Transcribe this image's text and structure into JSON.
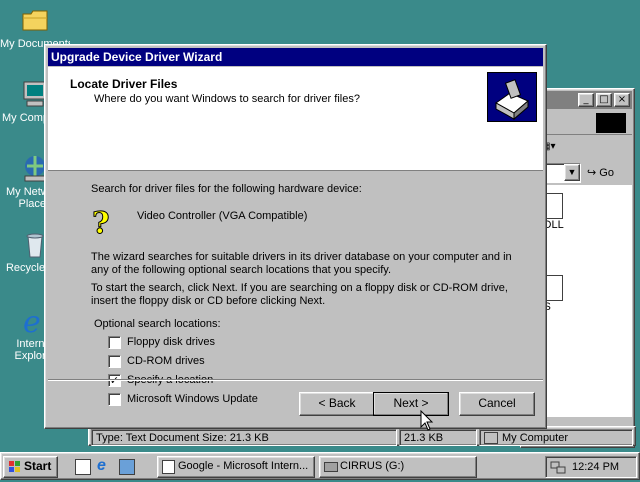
{
  "desktop": {
    "icons": [
      {
        "label": "My Documents",
        "icon": "folder-icon"
      },
      {
        "label": "My Computer",
        "icon": "computer-icon"
      },
      {
        "label": "My Network Places",
        "icon": "network-icon"
      },
      {
        "label": "Recycle Bin",
        "icon": "recycle-bin-icon"
      },
      {
        "label": "Internet Explorer",
        "icon": "ie-icon"
      }
    ]
  },
  "background_window": {
    "go_label": "Go",
    "file1": "EL.DLL",
    "file2": "NGS",
    "status_left": "Type: Text Document Size: 21.3 KB",
    "status_mid": "21.3 KB",
    "status_right": "My Computer"
  },
  "dialog": {
    "title": "Upgrade Device Driver Wizard",
    "header_title": "Locate Driver Files",
    "header_subtitle": "Where do you want Windows to search for driver files?",
    "intro": "Search for driver files for the following hardware device:",
    "device_name": "Video Controller (VGA Compatible)",
    "para1_line1": "The wizard searches for suitable drivers in its driver database on your computer and in",
    "para1_line2": "any of the following optional search locations that you specify.",
    "para2_line1": "To start the search, click Next. If you are searching on a floppy disk or CD-ROM drive,",
    "para2_line2": "insert the floppy disk or CD before clicking Next.",
    "optional_label": "Optional search locations:",
    "options": [
      {
        "label": "Floppy disk drives",
        "checked": false,
        "mark": ""
      },
      {
        "label": "CD-ROM drives",
        "checked": false,
        "mark": ""
      },
      {
        "label": "Specify a location",
        "checked": true,
        "mark": "✓"
      },
      {
        "label": "Microsoft Windows Update",
        "checked": false,
        "mark": ""
      }
    ],
    "back_label": "< Back",
    "next_label": "Next >",
    "cancel_label": "Cancel"
  },
  "taskbar": {
    "start_label": "Start",
    "tasks": [
      {
        "label": "Google - Microsoft Intern...",
        "icon": "ie-page-icon"
      },
      {
        "label": "CIRRUS (G:)",
        "icon": "drive-icon"
      }
    ],
    "clock": "12:24 PM"
  }
}
